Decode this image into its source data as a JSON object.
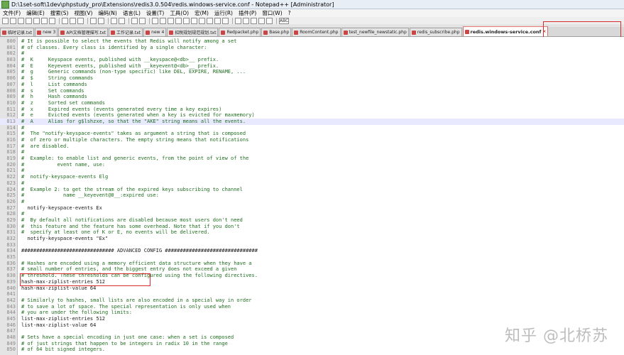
{
  "window": {
    "title": "D:\\1set-soft\\1dev\\phpstudy_pro\\Extensions\\redis3.0.504\\redis.windows-service.conf - Notepad++ [Administrator]"
  },
  "menu": [
    "文件(F)",
    "编辑(E)",
    "搜索(S)",
    "视图(V)",
    "编码(N)",
    "语言(L)",
    "设置(T)",
    "工具(O)",
    "宏(M)",
    "运行(R)",
    "插件(P)",
    "窗口(W)",
    "?"
  ],
  "toolbar": {
    "abc_label": "ABC"
  },
  "tabs": [
    {
      "label": "临时记录.txt"
    },
    {
      "label": "new 3"
    },
    {
      "label": "API文档管理描写.txt"
    },
    {
      "label": "工作记录.txt"
    },
    {
      "label": "new 4"
    },
    {
      "label": "招税规划规范规划.txt"
    },
    {
      "label": "Redpacket.php"
    },
    {
      "label": "Base.php"
    },
    {
      "label": "RoomContent.php"
    },
    {
      "label": "test_newfile_newstatic.php"
    },
    {
      "label": "redis_subscribe.php"
    },
    {
      "label": "redis.windows-service.conf",
      "active": true
    }
  ],
  "editor": {
    "current_line": "813",
    "lines": [
      {
        "n": "800",
        "t": "# It is possible to select the events that Redis will notify among a set"
      },
      {
        "n": "801",
        "t": "# of classes. Every class is identified by a single character:"
      },
      {
        "n": "802",
        "t": "#"
      },
      {
        "n": "803",
        "t": "#  K     Keyspace events, published with __keyspace@<db>__ prefix."
      },
      {
        "n": "804",
        "t": "#  E     Keyevent events, published with __keyevent@<db>__ prefix."
      },
      {
        "n": "805",
        "t": "#  g     Generic commands (non-type specific) like DEL, EXPIRE, RENAME, ..."
      },
      {
        "n": "806",
        "t": "#  $     String commands"
      },
      {
        "n": "807",
        "t": "#  l     List commands"
      },
      {
        "n": "808",
        "t": "#  s     Set commands"
      },
      {
        "n": "809",
        "t": "#  h     Hash commands"
      },
      {
        "n": "810",
        "t": "#  z     Sorted set commands"
      },
      {
        "n": "811",
        "t": "#  x     Expired events (events generated every time a key expires)"
      },
      {
        "n": "812",
        "t": "#  e     Evicted events (events generated when a key is evicted for maxmemory)"
      },
      {
        "n": "813",
        "t": "#  A     Alias for g$lshzxe, so that the \"AKE\" string means all the events."
      },
      {
        "n": "814",
        "t": "#"
      },
      {
        "n": "815",
        "t": "#  The \"notify-keyspace-events\" takes as argument a string that is composed"
      },
      {
        "n": "816",
        "t": "#  of zero or multiple characters. The empty string means that notifications"
      },
      {
        "n": "817",
        "t": "#  are disabled."
      },
      {
        "n": "818",
        "t": "#"
      },
      {
        "n": "819",
        "t": "#  Example: to enable list and generic events, from the point of view of the"
      },
      {
        "n": "820",
        "t": "#           event name, use:"
      },
      {
        "n": "821",
        "t": "#"
      },
      {
        "n": "822",
        "t": "#  notify-keyspace-events Elg"
      },
      {
        "n": "823",
        "t": "#"
      },
      {
        "n": "824",
        "t": "#  Example 2: to get the stream of the expired keys subscribing to channel"
      },
      {
        "n": "825",
        "t": "#             name __keyevent@0__:expired use:"
      },
      {
        "n": "826",
        "t": "#"
      },
      {
        "n": "827",
        "t": "  notify-keyspace-events Ex"
      },
      {
        "n": "828",
        "t": "#"
      },
      {
        "n": "829",
        "t": "#  By default all notifications are disabled because most users don't need"
      },
      {
        "n": "830",
        "t": "#  this feature and the feature has some overhead. Note that if you don't"
      },
      {
        "n": "831",
        "t": "#  specify at least one of K or E, no events will be delivered."
      },
      {
        "n": "832",
        "t": "  notify-keyspace-events \"Ex\""
      },
      {
        "n": "833",
        "t": ""
      },
      {
        "n": "834",
        "t": "############################### ADVANCED CONFIG ###############################"
      },
      {
        "n": "835",
        "t": ""
      },
      {
        "n": "836",
        "t": "# Hashes are encoded using a memory efficient data structure when they have a"
      },
      {
        "n": "837",
        "t": "# small number of entries, and the biggest entry does not exceed a given"
      },
      {
        "n": "838",
        "t": "# threshold. These thresholds can be configured using the following directives."
      },
      {
        "n": "839",
        "t": "hash-max-ziplist-entries 512"
      },
      {
        "n": "840",
        "t": "hash-max-ziplist-value 64"
      },
      {
        "n": "841",
        "t": ""
      },
      {
        "n": "842",
        "t": "# Similarly to hashes, small lists are also encoded in a special way in order"
      },
      {
        "n": "843",
        "t": "# to save a lot of space. The special representation is only used when"
      },
      {
        "n": "844",
        "t": "# you are under the following limits:"
      },
      {
        "n": "845",
        "t": "list-max-ziplist-entries 512"
      },
      {
        "n": "846",
        "t": "list-max-ziplist-value 64"
      },
      {
        "n": "847",
        "t": ""
      },
      {
        "n": "848",
        "t": "# Sets have a special encoding in just one case: when a set is composed"
      },
      {
        "n": "849",
        "t": "# of just strings that happen to be integers in radix 10 in the range"
      },
      {
        "n": "850",
        "t": "# of 64 bit signed integers."
      }
    ]
  },
  "watermark": "知乎 @北桥苏"
}
